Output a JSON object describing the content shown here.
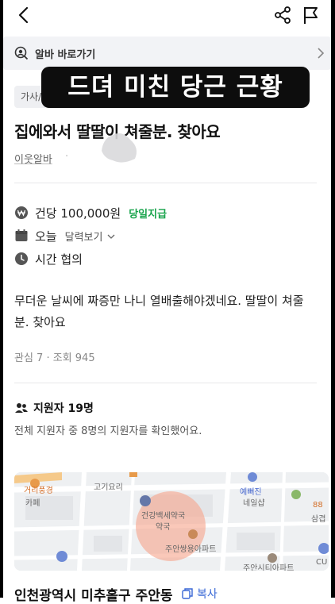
{
  "header": {
    "back_icon": "chevron-left-icon",
    "share_icon": "share-icon",
    "report_icon": "flag-icon"
  },
  "shortcut": {
    "label": "알바 바로가기",
    "icon": "user-search-icon"
  },
  "banner": {
    "text": "드뎌 미친 당근 근황"
  },
  "post": {
    "category": "가사/",
    "title": "집에와서 딸딸이 쳐줄분. 찾아요",
    "author": "이웃알바",
    "author_suffix": "· ",
    "pay": {
      "label": "건당 100,000원",
      "badge": "당일지급",
      "badge_color": "#16a34a"
    },
    "date": {
      "label": "오늘",
      "calendar_link": "달력보기"
    },
    "time": {
      "label": "시간 협의"
    },
    "description": "무더운 날씨에 짜증만 나니  열배출해야겠네요. 딸딸이 쳐줄분. 찾아요",
    "stats": "관심 7 · 조회 945"
  },
  "applicants": {
    "label": "지원자 19명",
    "sub": "전체 지원자 중 8명의 지원자를 확인했어요."
  },
  "map": {
    "labels": [
      "거리풍경",
      "카페",
      "고기요리",
      "건강백세약국",
      "약국",
      "주안쌍용아파트",
      "예뻐진",
      "네일샵",
      "88",
      "삼겹",
      "CU",
      "주안시티아파트"
    ]
  },
  "location": {
    "address": "인천광역시 미추홀구 주안동",
    "copy_label": "복사"
  },
  "colors": {
    "accent_green": "#16a34a",
    "link_blue": "#3867d6",
    "shortcut_bg": "#f2f3f6",
    "banner_bg": "#0d0d0d"
  }
}
